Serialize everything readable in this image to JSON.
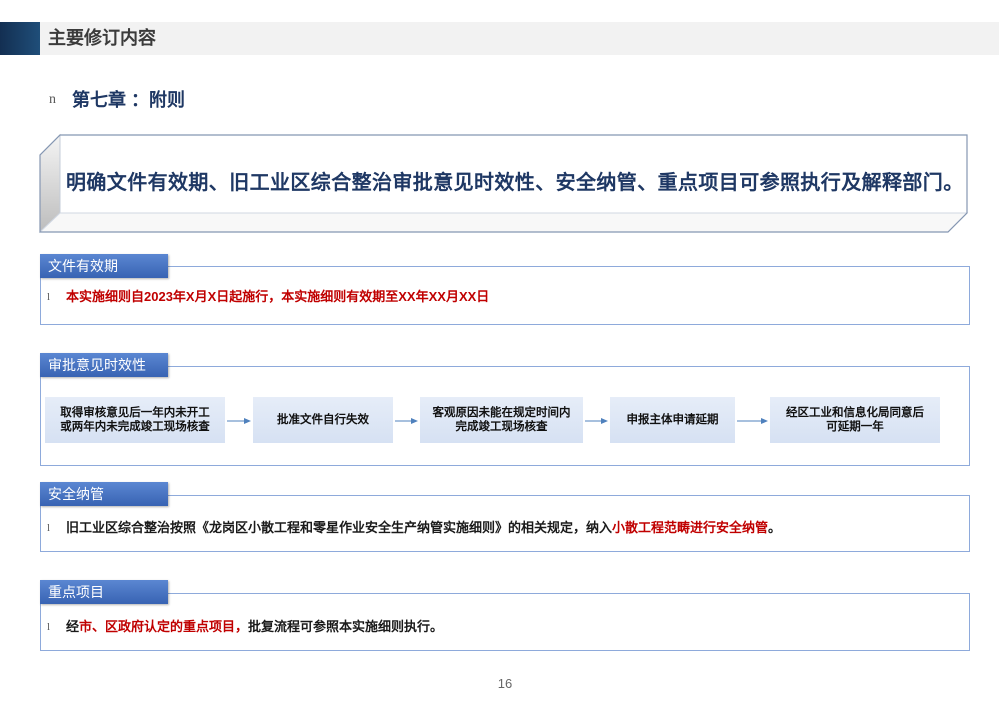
{
  "header": {
    "title": "主要修订内容"
  },
  "chapter": {
    "bullet": "n",
    "title": "第七章 ：附则"
  },
  "summary": {
    "text": "明确文件有效期、旧工业区综合整治审批意见时效性、安全纳管、重点项目可参照执行及解释部门。"
  },
  "validity": {
    "label": "文件有效期",
    "bullet": "l",
    "text": "本实施细则自2023年X月X日起施行，本实施细则有效期至XX年XX月XX日"
  },
  "approval": {
    "label": "审批意见时效性",
    "steps": [
      {
        "lines": [
          "取得审核意见后一年内未开工",
          "或两年内未完成竣工现场核查"
        ]
      },
      {
        "lines": [
          "批准文件自行失效"
        ]
      },
      {
        "lines": [
          "客观原因未能在规定时间内",
          "完成竣工现场核查"
        ]
      },
      {
        "lines": [
          "申报主体申请延期"
        ]
      },
      {
        "lines": [
          "经区工业和信息化局同意后",
          "可延期一年"
        ]
      }
    ],
    "connector_icon": "arrow-right-icon"
  },
  "safety": {
    "label": "安全纳管",
    "bullet": "l",
    "text_before": "旧工业区综合整治按照《龙岗区小散工程和零星作业安全生产纳管实施细则》的相关规定，纳入",
    "highlight": "小散工程范畴进行安全纳管",
    "text_after": "。"
  },
  "key_projects": {
    "label": "重点项目",
    "bullet": "l",
    "text_before": "经",
    "highlight": "市、区政府认定的重点项目，",
    "text_after": "批复流程可参照本实施细则执行。"
  },
  "page_number": "16",
  "colors": {
    "title_navy": "#1f3864",
    "highlight_red": "#c00000",
    "section_label_blue": "#4472c4",
    "header_block_blue": "#1f4e79",
    "step_fill": "#d6e1f3"
  }
}
